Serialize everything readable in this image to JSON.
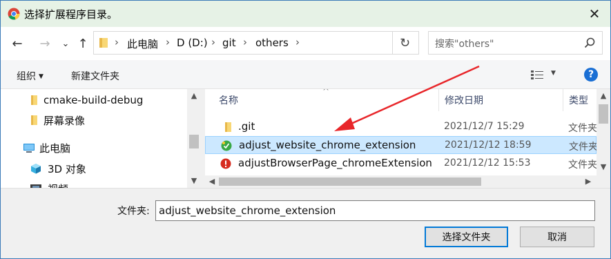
{
  "window": {
    "title": "选择扩展程序目录。",
    "close_glyph": "✕"
  },
  "nav": {
    "back_glyph": "←",
    "forward_glyph": "→",
    "recent_glyph": "⌄",
    "up_glyph": "↑",
    "crumbs": [
      "此电脑",
      "D (D:)",
      "git",
      "others"
    ],
    "separator": "›",
    "refresh_glyph": "↻",
    "search_placeholder": "搜索\"others\""
  },
  "toolbar": {
    "organize_label": "组织",
    "new_folder_label": "新建文件夹",
    "view_caret": "▼",
    "help_glyph": "?"
  },
  "tree": {
    "items": [
      {
        "label": "cmake-build-debug",
        "icon": "folder-icon"
      },
      {
        "label": "屏幕录像",
        "icon": "folder-icon"
      },
      {
        "label": "此电脑",
        "icon": "computer-icon"
      },
      {
        "label": "3D 对象",
        "icon": "3d-objects-icon"
      },
      {
        "label": "视频",
        "icon": "video-icon"
      }
    ]
  },
  "file_list": {
    "columns": [
      "名称",
      "修改日期",
      "类型"
    ],
    "sort_glyph": "^",
    "rows": [
      {
        "name": ".git",
        "date": "2021/12/7 15:29",
        "type": "文件夹",
        "icon": "folder-icon",
        "selected": false
      },
      {
        "name": "adjust_website_chrome_extension",
        "date": "2021/12/12 18:59",
        "type": "文件夹",
        "icon": "chrome-extension-icon",
        "selected": true
      },
      {
        "name": "adjustBrowserPage_chromeExtension",
        "date": "2021/12/12 15:53",
        "type": "文件夹",
        "icon": "warning-folder-icon",
        "selected": false
      }
    ]
  },
  "bottom": {
    "folder_label": "文件夹:",
    "folder_value": "adjust_website_chrome_extension",
    "select_button": "选择文件夹",
    "cancel_button": "取消"
  },
  "colors": {
    "title_bar": "#e6f2e6",
    "selection": "#cce8ff",
    "accent": "#0078d7",
    "annotation_arrow": "#e8262a"
  }
}
